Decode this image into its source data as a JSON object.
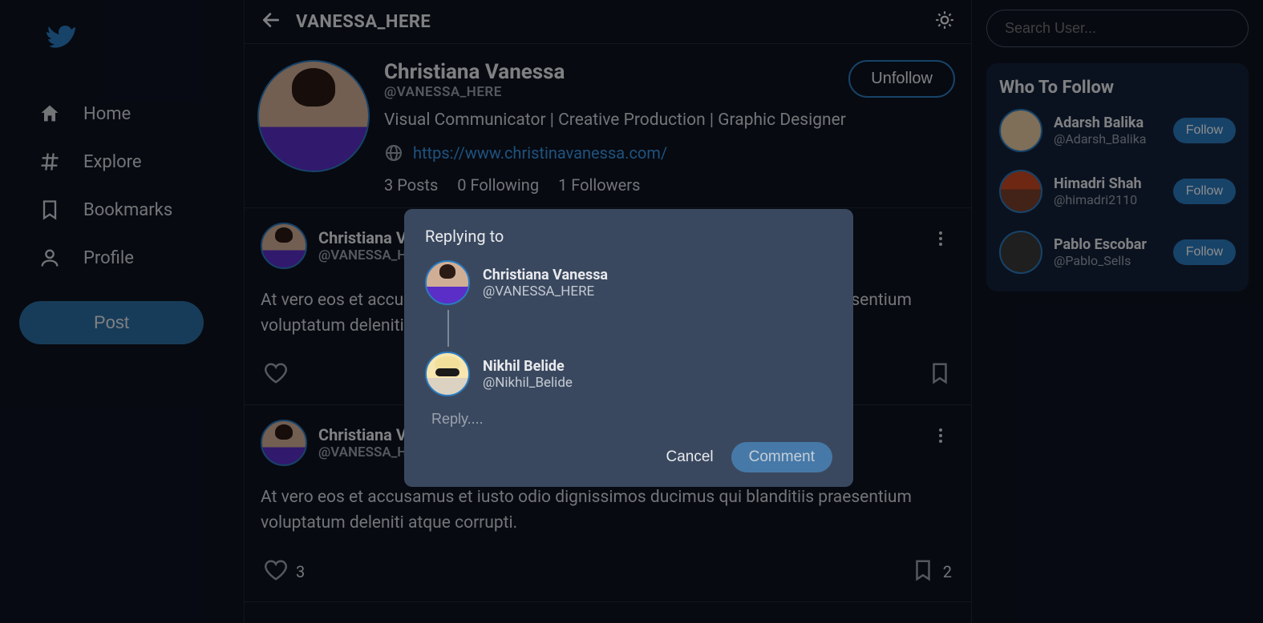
{
  "sidebar": {
    "items": [
      {
        "label": "Home"
      },
      {
        "label": "Explore"
      },
      {
        "label": "Bookmarks"
      },
      {
        "label": "Profile"
      }
    ],
    "post_button": "Post"
  },
  "header": {
    "title": "VANESSA_HERE"
  },
  "profile": {
    "display_name": "Christiana Vanessa",
    "handle": "@VANESSA_HERE",
    "bio": "Visual Communicator | Creative Production | Graphic Designer",
    "website": "https://www.christinavanessa.com/",
    "stats": {
      "posts": "3 Posts",
      "following": "0 Following",
      "followers": "1 Followers"
    },
    "unfollow_label": "Unfollow"
  },
  "posts": [
    {
      "author": "Christiana Vanessa",
      "handle": "@VANESSA_HERE",
      "body": "At vero eos et accusamus et iusto odio dignissimos ducimus qui blanditiis praesentium voluptatum deleniti atque corrupti.",
      "like_count": "",
      "bookmark_count": ""
    },
    {
      "author": "Christiana Vanessa",
      "handle": "@VANESSA_HERE",
      "body": "At vero eos et accusamus et iusto odio dignissimos ducimus qui blanditiis praesentium voluptatum deleniti atque corrupti.",
      "like_count": "3",
      "bookmark_count": "2"
    }
  ],
  "modal": {
    "title": "Replying to",
    "original_user": {
      "name": "Christiana Vanessa",
      "handle": "@VANESSA_HERE"
    },
    "replier": {
      "name": "Nikhil Belide",
      "handle": "@Nikhil_Belide"
    },
    "placeholder": "Reply....",
    "cancel": "Cancel",
    "comment": "Comment"
  },
  "right": {
    "search_placeholder": "Search User...",
    "wtf_title": "Who To Follow",
    "suggestions": [
      {
        "name": "Adarsh Balika",
        "handle": "@Adarsh_Balika",
        "follow": "Follow"
      },
      {
        "name": "Himadri Shah",
        "handle": "@himadri2110",
        "follow": "Follow"
      },
      {
        "name": "Pablo Escobar",
        "handle": "@Pablo_Sells",
        "follow": "Follow"
      }
    ]
  }
}
